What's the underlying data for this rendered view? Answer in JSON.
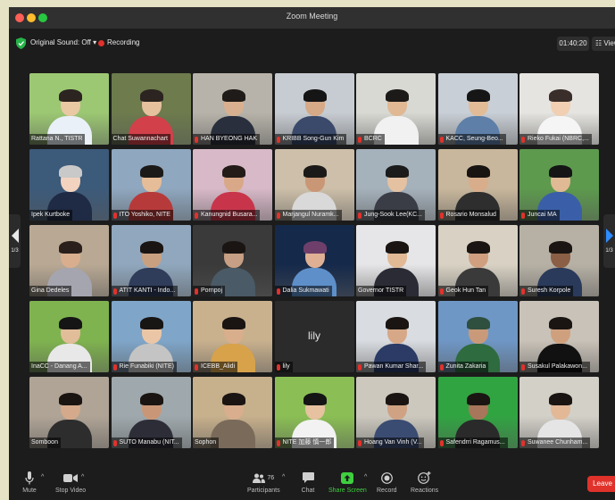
{
  "window": {
    "title": "Zoom Meeting"
  },
  "topbar": {
    "original_sound": "Original Sound: Off",
    "recording_label": "Recording",
    "timer": "01:40:20",
    "view_label": "View"
  },
  "pagination": {
    "left": "1/3",
    "right": "1/3"
  },
  "participants": [
    {
      "name": "Rattana N., TISTR",
      "muted": false
    },
    {
      "name": "Chat Suwannachart",
      "muted": false
    },
    {
      "name": "HAN BYEONG HAK",
      "muted": true
    },
    {
      "name": "KRIBB Song-Gun Kim",
      "muted": true
    },
    {
      "name": "BCRC",
      "muted": true
    },
    {
      "name": "KACC, Seung-Beo...",
      "muted": true
    },
    {
      "name": "Rieko Fukai (NBRC,...",
      "muted": true
    },
    {
      "name": "Ipek Kurtboke",
      "muted": false
    },
    {
      "name": "ITO Yoshiko, NITE",
      "muted": true
    },
    {
      "name": "Kanungnid Busara...",
      "muted": true
    },
    {
      "name": "Marjangul Nuramk...",
      "muted": true
    },
    {
      "name": "Jung-Sook Lee(KC...",
      "muted": true
    },
    {
      "name": "Rosario Monsalud",
      "muted": true
    },
    {
      "name": "Juncai MA",
      "muted": true
    },
    {
      "name": "Gina Dedeles",
      "muted": false
    },
    {
      "name": "ATIT KANTI - Indo...",
      "muted": true
    },
    {
      "name": "Pornpoj",
      "muted": true
    },
    {
      "name": "Dalia Sukmawati",
      "muted": true
    },
    {
      "name": "Governor TISTR",
      "muted": false
    },
    {
      "name": "Geok Hun Tan",
      "muted": true
    },
    {
      "name": "Suresh Korpole",
      "muted": true
    },
    {
      "name": "InaCC - Danang A...",
      "muted": false
    },
    {
      "name": "Rie Funabiki (NITE)",
      "muted": true
    },
    {
      "name": "ICEBB_Alidi",
      "muted": true
    },
    {
      "name": "lily",
      "muted": true
    },
    {
      "name": "Pawan Kumar Shar...",
      "muted": true
    },
    {
      "name": "Zunita Zakaria",
      "muted": true
    },
    {
      "name": "Susakul Palakawon...",
      "muted": true
    },
    {
      "name": "Somboon",
      "muted": false
    },
    {
      "name": "SUTO Manabu (NIT...",
      "muted": true
    },
    {
      "name": "Sophon",
      "muted": false
    },
    {
      "name": "NITE 加藤 慎一郎",
      "muted": true
    },
    {
      "name": "Hoang Van Vinh (V...",
      "muted": true
    },
    {
      "name": "Safendrri Ragamus...",
      "muted": true
    },
    {
      "name": "Suwanee Chunham...",
      "muted": true
    }
  ],
  "toolbar": {
    "mute": "Mute",
    "stop_video": "Stop Video",
    "participants_count": "76",
    "participants": "Participants",
    "chat": "Chat",
    "share_screen": "Share Screen",
    "record": "Record",
    "reactions": "Reactions",
    "leave": "Leave"
  },
  "colors": {
    "active_speaker": "#3fcf3f",
    "recording": "#e0322b",
    "share": "#3fcf3f",
    "leave": "#e0322b",
    "next_page": "#2d8cff"
  }
}
